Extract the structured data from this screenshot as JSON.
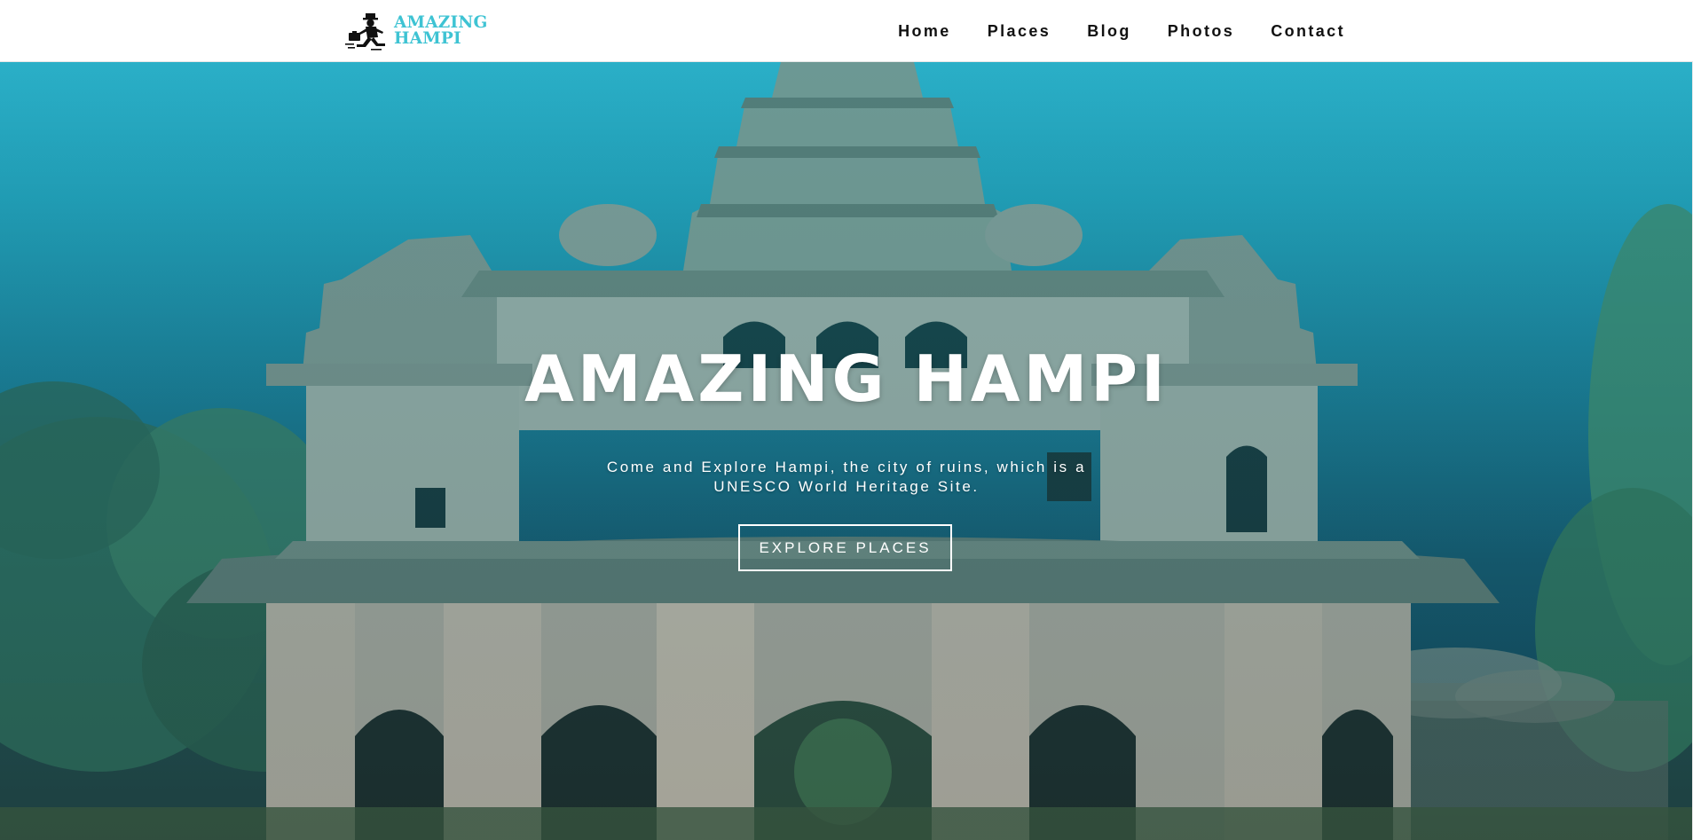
{
  "brand": {
    "line1": "AMAZING",
    "line2": "HAMPI",
    "logo_icon": "running-traveler-with-suitcase-icon",
    "accent_color": "#3ec3d3"
  },
  "nav": {
    "items": [
      {
        "label": "Home"
      },
      {
        "label": "Places"
      },
      {
        "label": "Blog"
      },
      {
        "label": "Photos"
      },
      {
        "label": "Contact"
      }
    ]
  },
  "hero": {
    "title": "AMAZING HAMPI",
    "subtitle": "Come and Explore Hampi, the city of ruins, which is a UNESCO World Heritage Site.",
    "cta_label": "EXPLORE PLACES",
    "background_image": "lotus-mahal-temple-photo",
    "overlay_color": "#23a3ba"
  }
}
